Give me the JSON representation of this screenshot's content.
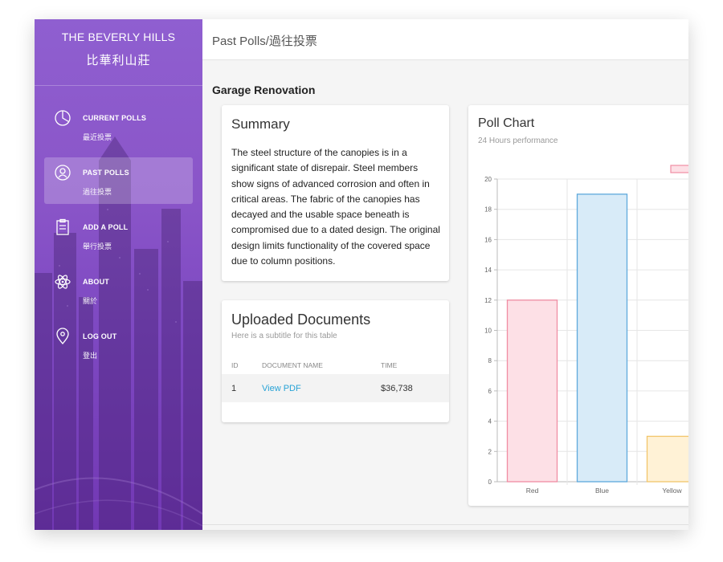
{
  "brand": {
    "name_en": "THE BEVERLY HILLS",
    "name_zh": "比華利山莊"
  },
  "sidebar": {
    "items": [
      {
        "label": "CURRENT POLLS",
        "sub": "最近投票",
        "icon": "pie-chart-icon",
        "active": false
      },
      {
        "label": "PAST POLLS",
        "sub": "過往投票",
        "icon": "users-icon",
        "active": true
      },
      {
        "label": "ADD A POLL",
        "sub": "舉行投票",
        "icon": "clipboard-icon",
        "active": false
      },
      {
        "label": "ABOUT",
        "sub": "關於",
        "icon": "atom-icon",
        "active": false
      },
      {
        "label": "LOG OUT",
        "sub": "登出",
        "icon": "location-pin-icon",
        "active": false
      }
    ]
  },
  "header": {
    "title": "Past Polls/過往投票"
  },
  "poll": {
    "title": "Garage Renovation"
  },
  "summary": {
    "title": "Summary",
    "text": "The steel structure of the canopies is in a significant state of disrepair. Steel members show signs of advanced corrosion and often in critical areas. The fabric of the canopies has decayed and the usable space beneath is compromised due to a dated design. The original design limits functionality of the covered space due to column positions."
  },
  "documents": {
    "title": "Uploaded Documents",
    "subtitle": "Here is a subtitle for this table",
    "headers": [
      "ID",
      "DOCUMENT NAME",
      "TIME"
    ],
    "rows": [
      {
        "id": "1",
        "name": "View PDF",
        "time": "$36,738"
      }
    ]
  },
  "chart": {
    "title": "Poll Chart",
    "subtitle": "24 Hours performance"
  },
  "chart_data": {
    "type": "bar",
    "categories": [
      "Red",
      "Blue",
      "Yellow"
    ],
    "values": [
      12,
      19,
      3
    ],
    "title": "Poll Chart",
    "subtitle": "24 Hours performance",
    "ylim": [
      0,
      20
    ],
    "yticks": [
      0,
      2,
      4,
      6,
      8,
      10,
      12,
      14,
      16,
      18,
      20
    ],
    "colors": [
      {
        "fill": "#fde0e6",
        "stroke": "#f08da3"
      },
      {
        "fill": "#d8ebf8",
        "stroke": "#5ea9dc"
      },
      {
        "fill": "#fff2d6",
        "stroke": "#f2c56b"
      }
    ],
    "legend_swatch": {
      "fill": "#fde0e6",
      "stroke": "#f08da3"
    },
    "grid": true
  }
}
